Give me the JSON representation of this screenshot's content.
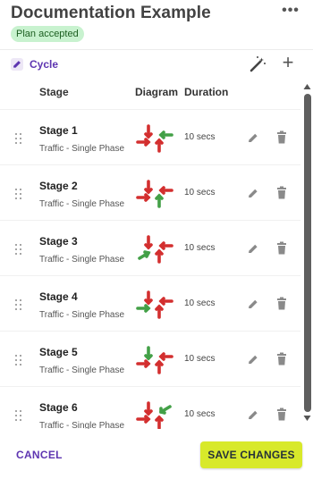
{
  "header": {
    "title": "Documentation Example",
    "status_badge": "Plan accepted",
    "more_icon": "more-horiz-icon"
  },
  "cycle": {
    "label": "Cycle",
    "icon": "pencil-icon",
    "tools": [
      "magic-wand-icon",
      "plus-icon"
    ]
  },
  "table": {
    "columns": [
      "Stage",
      "Diagram",
      "Duration"
    ]
  },
  "stages": [
    {
      "name": "Stage 1",
      "type": "Traffic - Single Phase",
      "duration": "10 secs"
    },
    {
      "name": "Stage 2",
      "type": "Traffic - Single Phase",
      "duration": "10 secs"
    },
    {
      "name": "Stage 3",
      "type": "Traffic - Single Phase",
      "duration": "10 secs"
    },
    {
      "name": "Stage 4",
      "type": "Traffic - Single Phase",
      "duration": "10 secs"
    },
    {
      "name": "Stage 5",
      "type": "Traffic - Single Phase",
      "duration": "10 secs"
    },
    {
      "name": "Stage 6",
      "type": "Traffic - Single Phase",
      "duration": "10 secs"
    }
  ],
  "footer": {
    "cancel_label": "CANCEL",
    "save_label": "SAVE CHANGES"
  },
  "colors": {
    "accent": "#5e35b1",
    "badge_bg": "#c8f2cf",
    "save_bg": "#d8e92a",
    "stop_arrow": "#d32f2f",
    "go_arrow": "#43a047"
  }
}
